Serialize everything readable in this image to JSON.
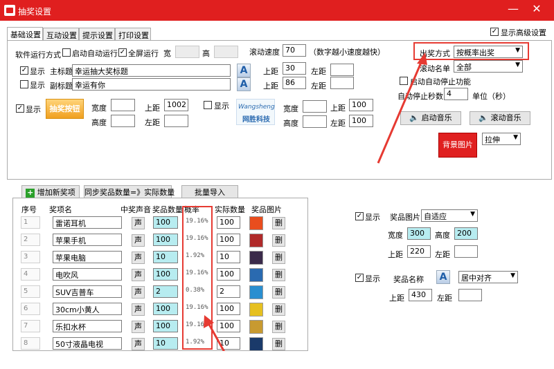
{
  "window": {
    "title": "抽奖设置",
    "min_glyph": "—",
    "close_glyph": "✕"
  },
  "tabs": [
    {
      "label": "基础设置"
    },
    {
      "label": "互动设置"
    },
    {
      "label": "提示设置"
    },
    {
      "label": "打印设置"
    }
  ],
  "advanced": {
    "label": "显示高级设置",
    "checked": true
  },
  "run_mode": {
    "label": "软件运行方式",
    "auto_run": "启动自动运行",
    "fullscreen": "全屏运行",
    "width_label": "宽",
    "height_label": "高",
    "width_value": "",
    "height_value": ""
  },
  "scroll_speed": {
    "label": "滚动速度",
    "value": "70",
    "hint": "（数字越小速度越快）"
  },
  "main_title": {
    "show_label": "显示",
    "label": "主标题",
    "value": "幸运抽大奖标题",
    "font_glyph": "A",
    "top_label": "上距",
    "top_value": "30",
    "left_label": "左距",
    "left_value": ""
  },
  "sub_title": {
    "show_label": "显示",
    "label": "副标题",
    "value": "幸运有你",
    "font_glyph": "A",
    "top_label": "上距",
    "top_value": "86",
    "left_label": "左距",
    "left_value": ""
  },
  "draw_button_logo": {
    "show_label": "显示",
    "button_text": "抽奖按钮",
    "width_label": "宽度",
    "height_label": "高度",
    "top_label": "上距",
    "left_label": "左距",
    "top_value": "1002",
    "width_value": "",
    "height_value": "",
    "left_value": ""
  },
  "logo": {
    "show_label": "显示",
    "text_top": "Wangsheng",
    "text_bottom": "网胜科技",
    "width_label": "宽度",
    "height_label": "高度",
    "top_label": "上距",
    "left_label": "左距",
    "top_value": "100",
    "left_value": "100",
    "width_value": "",
    "height_value": ""
  },
  "draw_mode": {
    "label": "出奖方式",
    "value": "按概率出奖"
  },
  "scroll_list": {
    "label": "滚动名单",
    "value": "全部"
  },
  "auto_stop": {
    "label": "启动自动停止功能",
    "seconds_label": "自动停止秒数",
    "value": "4",
    "unit": "单位（秒）"
  },
  "music": {
    "start": "启动音乐",
    "scroll": "滚动音乐"
  },
  "background": {
    "button": "背景图片",
    "stretch_value": "拉伸"
  },
  "prize_toolbar": {
    "add": "增加新奖项",
    "sync": "同步奖品数量=》实际数量",
    "import": "批量导入"
  },
  "prize_table": {
    "headers": [
      "序号",
      "奖项名",
      "中奖声音",
      "奖品数量",
      "概率",
      "实际数量",
      "奖品图片"
    ],
    "sound_label": "声",
    "delete_label": "删",
    "rows": [
      {
        "no": "1",
        "name": "雷诺耳机",
        "qty": "100",
        "prob": "19.16%",
        "actual": "100",
        "img_color": "#e94d1e"
      },
      {
        "no": "2",
        "name": "苹果手机",
        "qty": "100",
        "prob": "19.16%",
        "actual": "100",
        "img_color": "#b02a2a"
      },
      {
        "no": "3",
        "name": "苹果电脑",
        "qty": "10",
        "prob": "1.92%",
        "actual": "10",
        "img_color": "#3a2a4a"
      },
      {
        "no": "4",
        "name": "电吹风",
        "qty": "100",
        "prob": "19.16%",
        "actual": "100",
        "img_color": "#2a6ab0"
      },
      {
        "no": "5",
        "name": "SUV吉普车",
        "qty": "2",
        "prob": "0.38%",
        "actual": "2",
        "img_color": "#2a8fd0"
      },
      {
        "no": "6",
        "name": "30cm小黄人",
        "qty": "100",
        "prob": "19.16%",
        "actual": "100",
        "img_color": "#e6c020"
      },
      {
        "no": "7",
        "name": "乐扣水杯",
        "qty": "100",
        "prob": "19.16%",
        "actual": "100",
        "img_color": "#c89a30"
      },
      {
        "no": "8",
        "name": "50寸液晶电视",
        "qty": "10",
        "prob": "1.92%",
        "actual": "10",
        "img_color": "#1a3a6a"
      }
    ]
  },
  "prize_image_settings": {
    "show_label": "显示",
    "label": "奖品图片",
    "fit_value": "自适应",
    "width_label": "宽度",
    "width_value": "300",
    "height_label": "高度",
    "height_value": "200",
    "top_label": "上距",
    "top_value": "220",
    "left_label": "左距",
    "left_value": ""
  },
  "prize_name_settings": {
    "show_label": "显示",
    "label": "奖品名称",
    "font_glyph": "A",
    "align_value": "居中对齐",
    "top_label": "上距",
    "top_value": "430",
    "left_label": "左距",
    "left_value": ""
  },
  "colors": {
    "titlebar": "#e01f1f",
    "highlight": "#e63a32",
    "qty_fill": "#b7ecf0"
  }
}
